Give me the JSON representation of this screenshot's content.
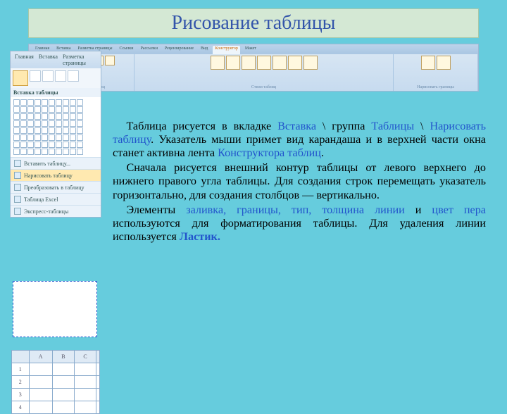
{
  "title": "Рисование таблицы",
  "ribbon": {
    "tabs": [
      "Главная",
      "Вставка",
      "Разметка страницы",
      "Ссылки",
      "Рассылки",
      "Рецензирование",
      "Вид",
      "Конструктор",
      "Макет"
    ],
    "active_tab_index": 7,
    "groups": {
      "g1": "Параметры стилей таблиц",
      "g2": "Стили таблиц",
      "g3": "Нарисовать границы"
    }
  },
  "dropdown": {
    "hdr1": "Главная",
    "hdr2": "Вставка",
    "hdr3": "Разметка страницы",
    "grid_title": "Вставка таблицы",
    "opt1": "Вставить таблицу...",
    "opt2": "Нарисовать таблицу",
    "opt3": "Преобразовать в таблицу",
    "opt4": "Таблица Excel",
    "opt5": "Экспресс-таблицы"
  },
  "sample": {
    "cols": [
      "",
      "A",
      "B",
      "C",
      ""
    ],
    "rows": [
      [
        "1",
        "",
        "",
        "",
        ""
      ],
      [
        "2",
        "",
        "",
        "",
        ""
      ],
      [
        "3",
        "",
        "",
        "",
        ""
      ],
      [
        "4",
        "",
        "",
        "",
        ""
      ]
    ]
  },
  "para": {
    "p1a": "Таблица рисуется в вкладке ",
    "kw1": "Вставка",
    "p1b": " \\ группа ",
    "kw2": "Таблицы",
    "p1c": " \\ ",
    "kw3": "Нарисовать таблицу",
    "p1d": ". Указатель мыши примет вид карандаша и в верхней части окна станет активна лента ",
    "kw4": "Конструктора таблиц",
    "p1e": ".",
    "p2": "Сначала рисуется внешний контур таблицы от левого верхнего до нижнего правого угла таб­лицы. Для создания строк перемещать указатель горизонтально, для создания столбцов — верти­кально.",
    "p3a": "Элементы ",
    "kw5": "заливка, границы, тип, толщина линии",
    "p3b": " и ",
    "kw6": "цвет пера",
    "p3c": " используются для форматирования таблицы. Для удаления линии используется ",
    "kw7": "Ластик.",
    "p3d": ""
  }
}
